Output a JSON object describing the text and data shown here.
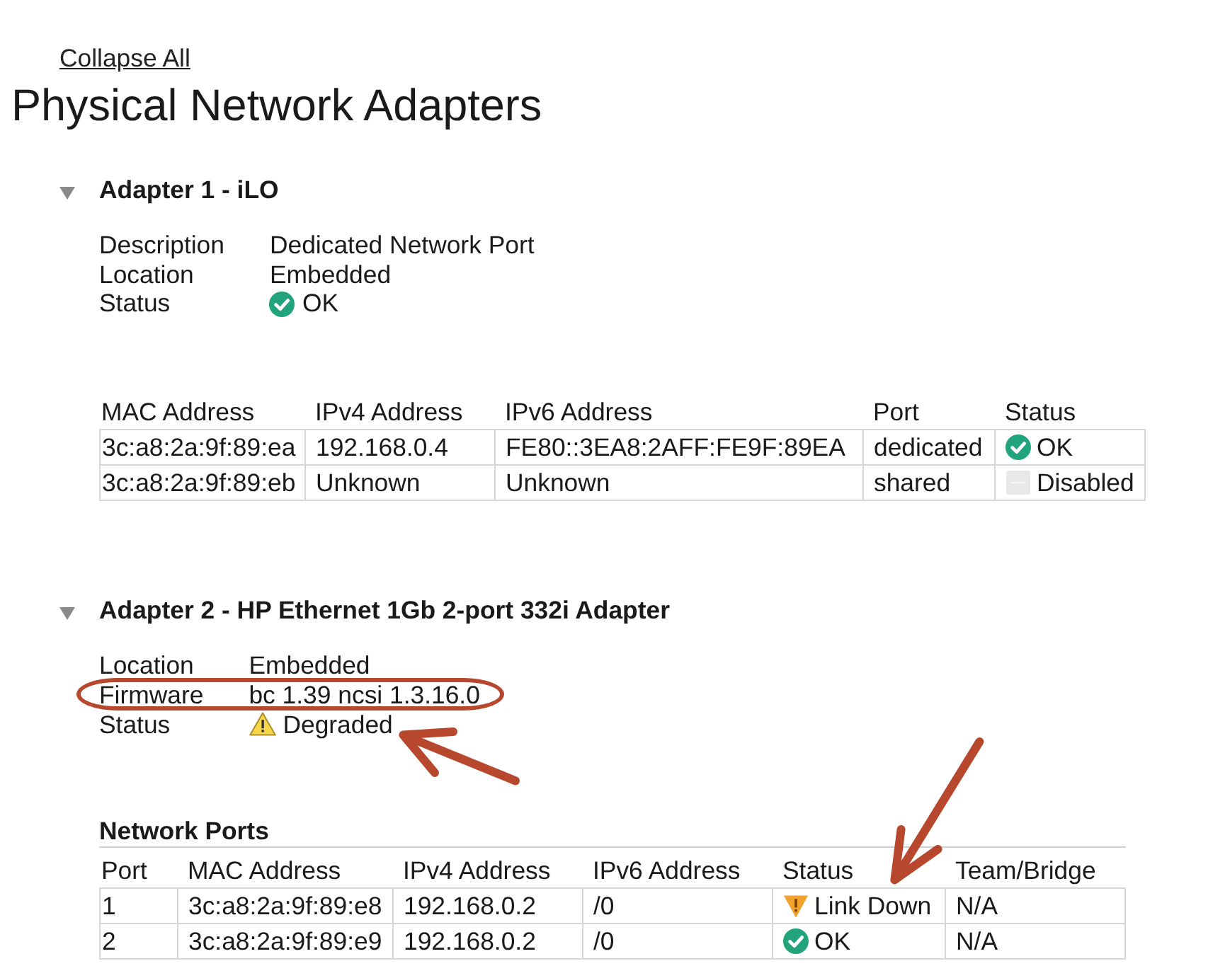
{
  "collapse_all": "Collapse All",
  "title": "Physical Network Adapters",
  "adapters": [
    {
      "title": "Adapter 1 - iLO",
      "expanded": true,
      "properties": [
        {
          "label": "Description",
          "value": "Dedicated Network Port",
          "kind": "text",
          "circled": false,
          "pointed_at": false
        },
        {
          "label": "Location",
          "value": "Embedded",
          "kind": "text",
          "circled": false,
          "pointed_at": false
        },
        {
          "label": "Status",
          "value": "OK",
          "kind": "ok",
          "circled": false,
          "pointed_at": false
        }
      ],
      "table": {
        "columns": [
          "MAC Address",
          "IPv4 Address",
          "IPv6 Address",
          "Port",
          "Status"
        ],
        "rows": [
          [
            {
              "text": "3c:a8:2a:9f:89:ea"
            },
            {
              "text": "192.168.0.4"
            },
            {
              "text": "FE80::3EA8:2AFF:FE9F:89EA"
            },
            {
              "text": "dedicated"
            },
            {
              "text": "OK",
              "kind": "ok",
              "pointed_at": false
            }
          ],
          [
            {
              "text": "3c:a8:2a:9f:89:eb"
            },
            {
              "text": "Unknown"
            },
            {
              "text": "Unknown"
            },
            {
              "text": "shared"
            },
            {
              "text": "Disabled",
              "kind": "disabled",
              "pointed_at": false
            }
          ]
        ]
      }
    },
    {
      "title": "Adapter 2 - HP Ethernet 1Gb 2-port 332i Adapter",
      "expanded": true,
      "properties": [
        {
          "label": "Location",
          "value": "Embedded",
          "kind": "text",
          "circled": false,
          "pointed_at": false
        },
        {
          "label": "Firmware",
          "value": "bc 1.39 ncsi 1.3.16.0",
          "kind": "text",
          "circled": true,
          "pointed_at": false
        },
        {
          "label": "Status",
          "value": "Degraded",
          "kind": "warning",
          "circled": false,
          "pointed_at": true
        }
      ],
      "table": {
        "caption": "Network Ports",
        "columns": [
          "Port",
          "MAC Address",
          "IPv4 Address",
          "IPv6 Address",
          "Status",
          "Team/Bridge"
        ],
        "rows": [
          [
            {
              "text": "1"
            },
            {
              "text": "3c:a8:2a:9f:89:e8"
            },
            {
              "text": "192.168.0.2"
            },
            {
              "text": "/0"
            },
            {
              "text": "Link Down",
              "kind": "link_down",
              "pointed_at": true
            },
            {
              "text": "N/A"
            }
          ],
          [
            {
              "text": "2"
            },
            {
              "text": "3c:a8:2a:9f:89:e9"
            },
            {
              "text": "192.168.0.2"
            },
            {
              "text": "/0"
            },
            {
              "text": "OK",
              "kind": "ok",
              "pointed_at": false
            },
            {
              "text": "N/A"
            }
          ]
        ]
      }
    }
  ]
}
